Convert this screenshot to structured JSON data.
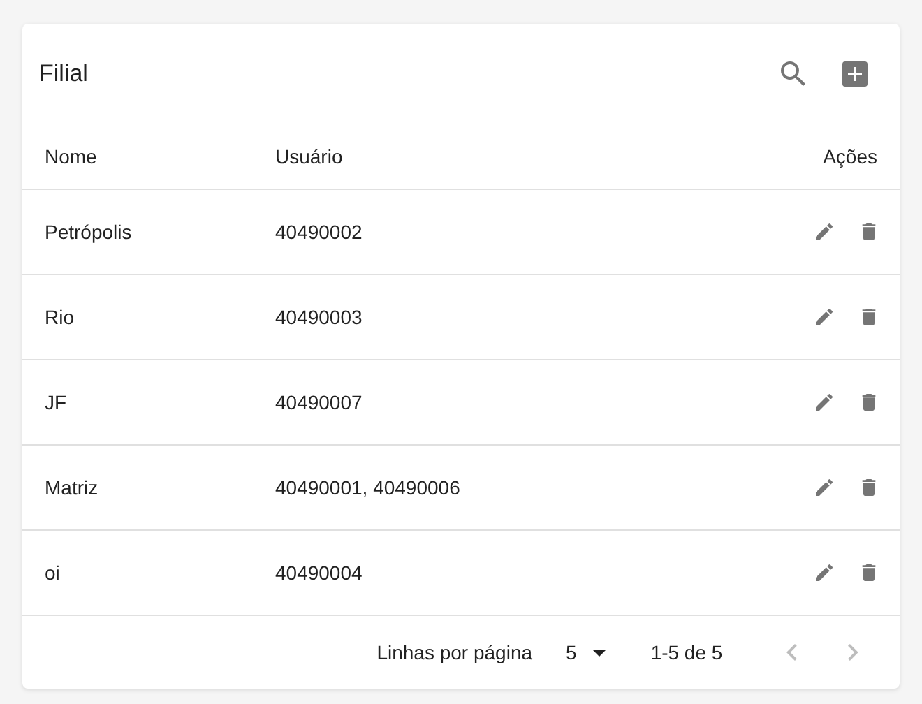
{
  "toolbar": {
    "title": "Filial"
  },
  "table": {
    "columns": [
      "Nome",
      "Usuário",
      "Ações"
    ],
    "rows": [
      {
        "nome": "Petrópolis",
        "usuario": "40490002"
      },
      {
        "nome": "Rio",
        "usuario": "40490003"
      },
      {
        "nome": "JF",
        "usuario": "40490007"
      },
      {
        "nome": "Matriz",
        "usuario": "40490001, 40490006"
      },
      {
        "nome": "oi",
        "usuario": "40490004"
      }
    ]
  },
  "pagination": {
    "rows_label": "Linhas por página",
    "rows_per_page": "5",
    "range": "1-5 de 5",
    "prev_disabled": true,
    "next_disabled": true
  }
}
